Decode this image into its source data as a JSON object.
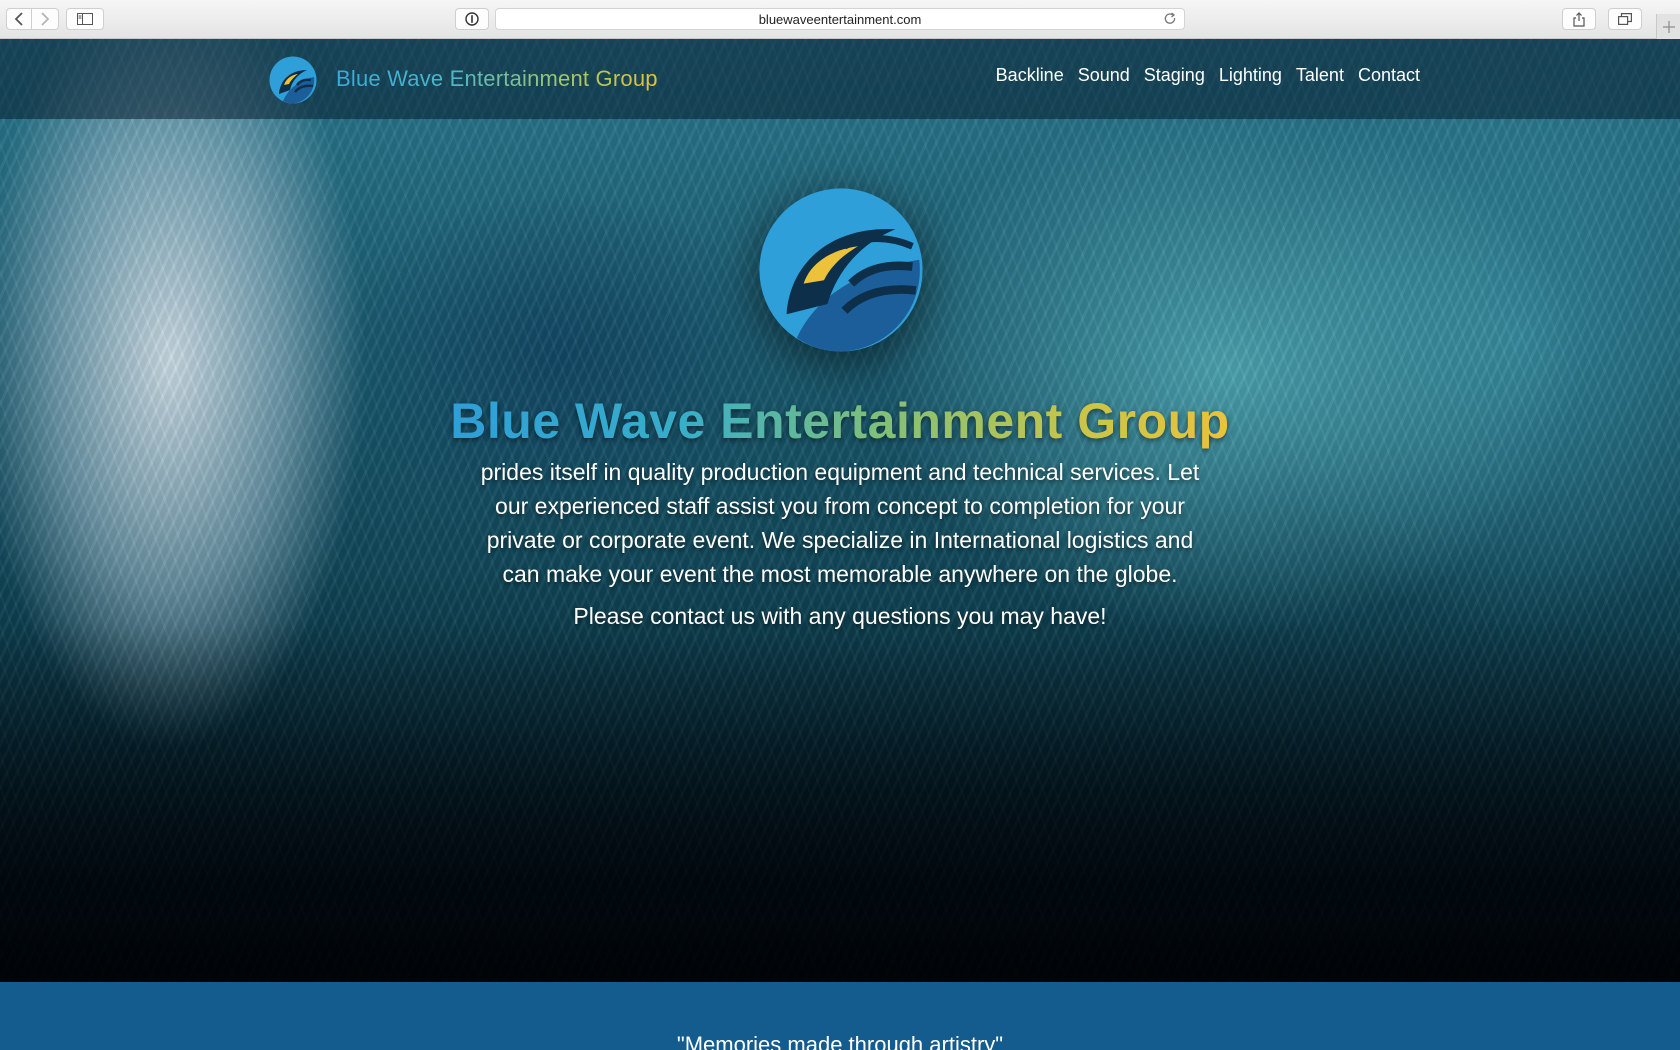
{
  "browser": {
    "url": "bluewaveentertainment.com",
    "icons": [
      "back-icon",
      "forward-icon",
      "sidebar-icon",
      "info-icon",
      "reload-icon",
      "share-icon",
      "tabs-icon",
      "new-tab-icon"
    ]
  },
  "nav": {
    "brand": "Blue Wave Entertainment Group",
    "links": [
      "Backline",
      "Sound",
      "Staging",
      "Lighting",
      "Talent",
      "Contact"
    ]
  },
  "hero": {
    "title": "Blue Wave Entertainment Group",
    "description": "prides itself in quality production equipment and technical services. Let our experienced staff assist you from concept to completion for your private or corporate event. We specialize in International logistics and can make your event the most memorable anywhere on the globe.",
    "contact_line": "Please contact us with any questions you may have!"
  },
  "tagline": "\"Memories made through artistry\"",
  "colors": {
    "brand_blue": "#2e9fd8",
    "brand_dark_blue": "#1b5e9a",
    "brand_yellow": "#ecc23a",
    "tagline_bg": "#145b8e"
  }
}
